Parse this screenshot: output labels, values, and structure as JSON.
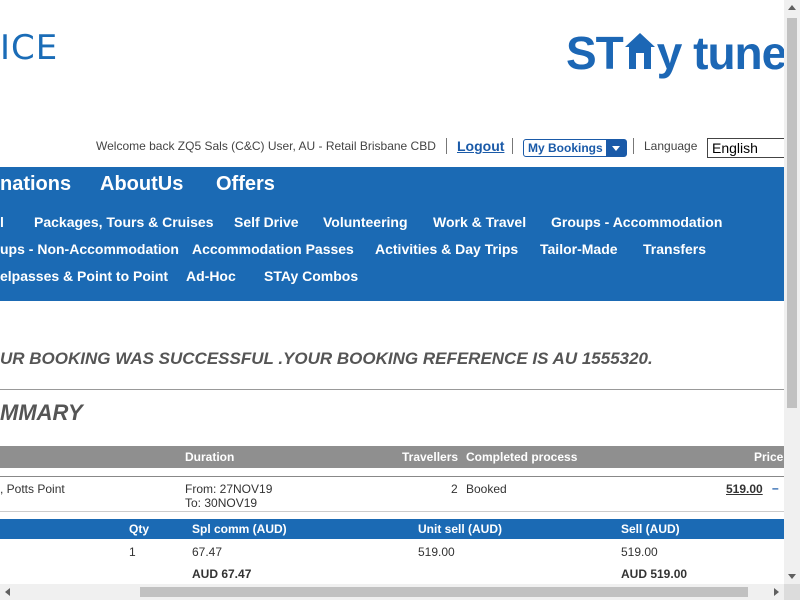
{
  "header": {
    "logo_left_text": "ICE",
    "logo_right_part1": "ST",
    "logo_right_part2": "y tuned"
  },
  "topbar": {
    "welcome": "Welcome back ZQ5 Sals (C&C) User, AU - Retail Brisbane CBD",
    "logout": "Logout",
    "my_bookings": "My Bookings",
    "language_label": "Language",
    "language_value": "English"
  },
  "main_nav": [
    "nations",
    "AboutUs",
    "Offers"
  ],
  "sub_nav": [
    [
      "l",
      "Packages, Tours & Cruises",
      "Self Drive",
      "Volunteering",
      "Work & Travel",
      "Groups - Accommodation"
    ],
    [
      "ups - Non-Accommodation",
      "Accommodation Passes",
      "Activities & Day Trips",
      "Tailor-Made",
      "Transfers"
    ],
    [
      "elpasses & Point to Point",
      "Ad-Hoc",
      "STAy Combos"
    ]
  ],
  "message": {
    "success": "UR BOOKING WAS SUCCESSFUL .YOUR BOOKING REFERENCE IS AU 1555320.",
    "summary_title": "MMARY"
  },
  "booking_table": {
    "headers": {
      "duration": "Duration",
      "travellers": "Travellers",
      "completed": "Completed process",
      "price": "Price"
    },
    "row": {
      "name": ", Potts Point",
      "from": "From: 27NOV19",
      "to": "To: 30NOV19",
      "travellers": "2",
      "status": "Booked",
      "price": "519.00",
      "collapse": "–"
    }
  },
  "pricing_table": {
    "headers": {
      "qty": "Qty",
      "spl_comm": "Spl comm (AUD)",
      "unit_sell": "Unit sell (AUD)",
      "sell": "Sell (AUD)"
    },
    "row": {
      "qty": "1",
      "spl_comm": "67.47",
      "unit_sell": "519.00",
      "sell": "519.00"
    },
    "totals": {
      "spl_comm": "AUD 67.47",
      "sell": "AUD 519.00"
    }
  }
}
